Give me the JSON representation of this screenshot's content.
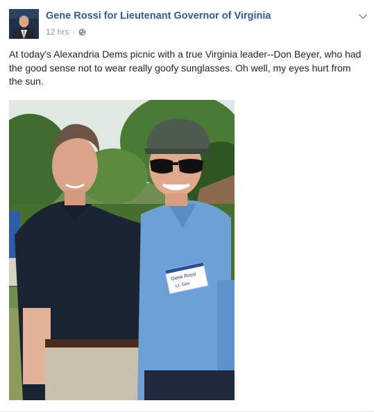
{
  "post": {
    "author": "Gene Rossi for Lieutenant Governor of Virginia",
    "timestamp": "12 hrs",
    "privacy_icon": "globe-icon",
    "menu_icon": "chevron-down-icon",
    "text": "At today's Alexandria Dems picnic with a true Virginia leader--Don Beyer, who had the good sense not to wear really goofy sunglasses. Oh well, my eyes hurt from the sun.",
    "photo": {
      "name_tag_lines": [
        "Gene Rossi",
        "Lt. Gov"
      ]
    }
  },
  "colors": {
    "link": "#365899",
    "meta": "#90949c",
    "text": "#1d2129"
  }
}
